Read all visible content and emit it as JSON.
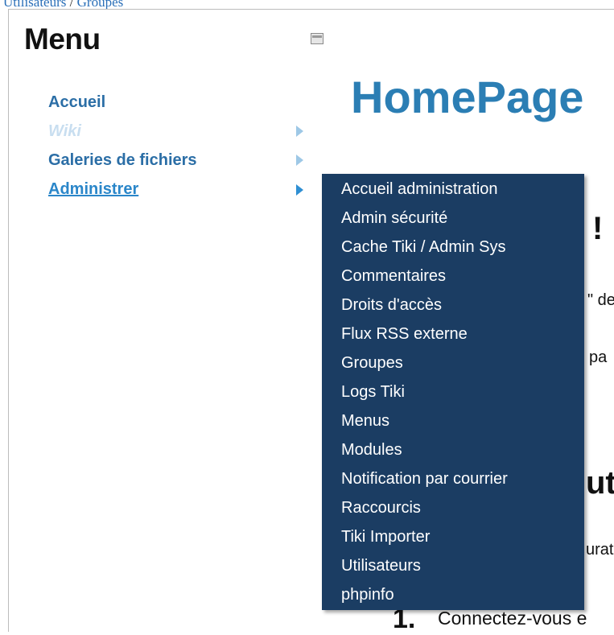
{
  "breadcrumb": {
    "left": "Utilisateurs",
    "separator": " / ",
    "right": "Groupes"
  },
  "menu": {
    "title": "Menu",
    "items": [
      {
        "label": "Accueil",
        "state": "normal",
        "has_submenu": false
      },
      {
        "label": "Wiki",
        "state": "disabled",
        "has_submenu": true
      },
      {
        "label": "Galeries de fichiers",
        "state": "normal",
        "has_submenu": true
      },
      {
        "label": "Administrer",
        "state": "active",
        "has_submenu": true
      }
    ]
  },
  "content": {
    "title": "HomePage",
    "fragments": [
      "!",
      "\" de",
      "pa",
      "ut",
      "urat",
      "1.",
      "Connectez-vous e"
    ]
  },
  "submenu": {
    "items": [
      "Accueil administration",
      "Admin sécurité",
      "Cache Tiki / Admin Sys",
      "Commentaires",
      "Droits d'accès",
      "Flux RSS externe",
      "Groupes",
      "Logs Tiki",
      "Menus",
      "Modules",
      "Notification par courrier",
      "Raccourcis",
      "Tiki Importer",
      "Utilisateurs",
      "phpinfo"
    ]
  },
  "colors": {
    "link": "#2b6ea6",
    "link_active": "#2a86c9",
    "submenu_bg": "#1b3d63",
    "title": "#2b7eb4"
  }
}
